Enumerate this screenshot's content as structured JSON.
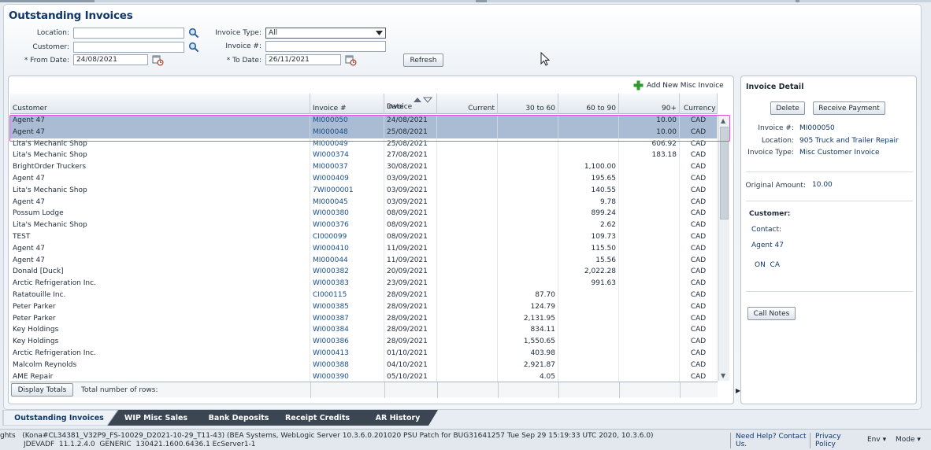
{
  "page": {
    "title": "Outstanding Invoices"
  },
  "filters": {
    "location_label": "Location:",
    "location_value": "",
    "customer_label": "Customer:",
    "customer_value": "",
    "from_date_label": "* From Date:",
    "from_date_value": "24/08/2021",
    "invoice_type_label": "Invoice Type:",
    "invoice_type_value": "All",
    "invoice_no_label": "Invoice #:",
    "invoice_no_value": "",
    "to_date_label": "* To Date:",
    "to_date_value": "26/11/2021",
    "refresh_label": "Refresh"
  },
  "table": {
    "add_misc_label": "Add New Misc Invoice",
    "columns": {
      "customer": "Customer",
      "invoice_no": "Invoice #",
      "invoice_date_line1": "Invoice",
      "invoice_date_line2": "Date",
      "current": "Current",
      "d30_60": "30 to 60",
      "d60_90": "60 to 90",
      "d90plus": "90+",
      "currency": "Currency"
    },
    "rows": [
      {
        "customer": "Agent 47",
        "invoice": "MI000050",
        "date": "24/08/2021",
        "current": "",
        "d30": "",
        "d60": "",
        "d90": "10.00",
        "cur": "CAD"
      },
      {
        "customer": "Agent 47",
        "invoice": "MI000048",
        "date": "25/08/2021",
        "current": "",
        "d30": "",
        "d60": "",
        "d90": "10.00",
        "cur": "CAD"
      },
      {
        "customer": "Lita's Mechanic Shop",
        "invoice": "MI000049",
        "date": "25/08/2021",
        "current": "",
        "d30": "",
        "d60": "",
        "d90": "606.92",
        "cur": "CAD"
      },
      {
        "customer": "Lita's Mechanic Shop",
        "invoice": "WI000374",
        "date": "27/08/2021",
        "current": "",
        "d30": "",
        "d60": "",
        "d90": "183.18",
        "cur": "CAD"
      },
      {
        "customer": "BrightOrder Truckers",
        "invoice": "MI000037",
        "date": "30/08/2021",
        "current": "",
        "d30": "",
        "d60": "1,100.00",
        "d90": "",
        "cur": "CAD"
      },
      {
        "customer": "Agent 47",
        "invoice": "WI000409",
        "date": "03/09/2021",
        "current": "",
        "d30": "",
        "d60": "195.65",
        "d90": "",
        "cur": "CAD"
      },
      {
        "customer": "Lita's Mechanic Shop",
        "invoice": "7WI000001",
        "date": "03/09/2021",
        "current": "",
        "d30": "",
        "d60": "140.55",
        "d90": "",
        "cur": "CAD"
      },
      {
        "customer": "Agent 47",
        "invoice": "MI000045",
        "date": "03/09/2021",
        "current": "",
        "d30": "",
        "d60": "9.78",
        "d90": "",
        "cur": "CAD"
      },
      {
        "customer": "Possum Lodge",
        "invoice": "WI000380",
        "date": "08/09/2021",
        "current": "",
        "d30": "",
        "d60": "899.24",
        "d90": "",
        "cur": "CAD"
      },
      {
        "customer": "Lita's Mechanic Shop",
        "invoice": "WI000376",
        "date": "08/09/2021",
        "current": "",
        "d30": "",
        "d60": "2.62",
        "d90": "",
        "cur": "CAD"
      },
      {
        "customer": "TEST",
        "invoice": "CI000099",
        "date": "08/09/2021",
        "current": "",
        "d30": "",
        "d60": "109.73",
        "d90": "",
        "cur": "CAD"
      },
      {
        "customer": "Agent 47",
        "invoice": "WI000410",
        "date": "11/09/2021",
        "current": "",
        "d30": "",
        "d60": "115.50",
        "d90": "",
        "cur": "CAD"
      },
      {
        "customer": "Agent 47",
        "invoice": "MI000044",
        "date": "11/09/2021",
        "current": "",
        "d30": "",
        "d60": "15.56",
        "d90": "",
        "cur": "CAD"
      },
      {
        "customer": "Donald [Duck]",
        "invoice": "WI000382",
        "date": "20/09/2021",
        "current": "",
        "d30": "",
        "d60": "2,022.28",
        "d90": "",
        "cur": "CAD"
      },
      {
        "customer": "Arctic Refrigeration Inc.",
        "invoice": "WI000383",
        "date": "23/09/2021",
        "current": "",
        "d30": "",
        "d60": "991.63",
        "d90": "",
        "cur": "CAD"
      },
      {
        "customer": "Ratatouille Inc.",
        "invoice": "CI000115",
        "date": "28/09/2021",
        "current": "",
        "d30": "87.70",
        "d60": "",
        "d90": "",
        "cur": "CAD"
      },
      {
        "customer": "Peter Parker",
        "invoice": "WI000385",
        "date": "28/09/2021",
        "current": "",
        "d30": "124.79",
        "d60": "",
        "d90": "",
        "cur": "CAD"
      },
      {
        "customer": "Peter Parker",
        "invoice": "WI000387",
        "date": "28/09/2021",
        "current": "",
        "d30": "2,131.95",
        "d60": "",
        "d90": "",
        "cur": "CAD"
      },
      {
        "customer": "Key Holdings",
        "invoice": "WI000384",
        "date": "28/09/2021",
        "current": "",
        "d30": "834.11",
        "d60": "",
        "d90": "",
        "cur": "CAD"
      },
      {
        "customer": "Key Holdings",
        "invoice": "WI000386",
        "date": "28/09/2021",
        "current": "",
        "d30": "1,550.65",
        "d60": "",
        "d90": "",
        "cur": "CAD"
      },
      {
        "customer": "Arctic Refrigeration Inc.",
        "invoice": "WI000413",
        "date": "01/10/2021",
        "current": "",
        "d30": "403.98",
        "d60": "",
        "d90": "",
        "cur": "CAD"
      },
      {
        "customer": "Malcolm Reynolds",
        "invoice": "WI000388",
        "date": "04/10/2021",
        "current": "",
        "d30": "2,921.87",
        "d60": "",
        "d90": "",
        "cur": "CAD"
      },
      {
        "customer": "AME Repair",
        "invoice": "WI000390",
        "date": "05/10/2021",
        "current": "",
        "d30": "4.05",
        "d60": "",
        "d90": "",
        "cur": "CAD"
      }
    ],
    "display_totals_label": "Display Totals",
    "total_rows_label": "Total number of rows:"
  },
  "detail": {
    "title": "Invoice Detail",
    "delete_label": "Delete",
    "receive_payment_label": "Receive Payment",
    "invoice_no_label": "Invoice #:",
    "invoice_no_value": "MI000050",
    "location_label": "Location:",
    "location_value": "905 Truck and Trailer Repair",
    "invoice_type_label": "Invoice Type:",
    "invoice_type_value": "Misc Customer Invoice",
    "original_amount_label": "Original Amount:",
    "original_amount_value": "10.00",
    "customer_heading": "Customer:",
    "contact_label": "Contact:",
    "contact_name": "Agent 47",
    "region": "ON  CA",
    "call_notes_label": "Call Notes"
  },
  "tabs": [
    {
      "label": "Outstanding Invoices"
    },
    {
      "label": "WIP Misc Sales"
    },
    {
      "label": "Bank Deposits"
    },
    {
      "label": "Receipt Credits"
    },
    {
      "label": "AR History"
    }
  ],
  "status": {
    "line1": "ghts   (Kona#CL34381_V32P9_FS-10029_D2021-10-29_T11-43) (BEA Systems, WebLogic Server 10.3.6.0.201020 PSU Patch for BUG31641257 Tue Sep 29 15:19:33 UTC 2020, 10.3.6.0)",
    "line2": "JDEVADF  11.1.2.4.0  GENERIC  130421.1600.6436.1 EcServer1-1",
    "help_line1": "Need Help? Contact",
    "help_line2": "Us.",
    "privacy_line1": "Privacy",
    "privacy_line2": "Policy",
    "env_label": "Env",
    "mode_label": "Mode"
  },
  "colors": {
    "accent": "#10386b",
    "selected_row": "#a9bcd3",
    "highlight": "#e04ce0",
    "tab_dark": "#3b4652"
  }
}
